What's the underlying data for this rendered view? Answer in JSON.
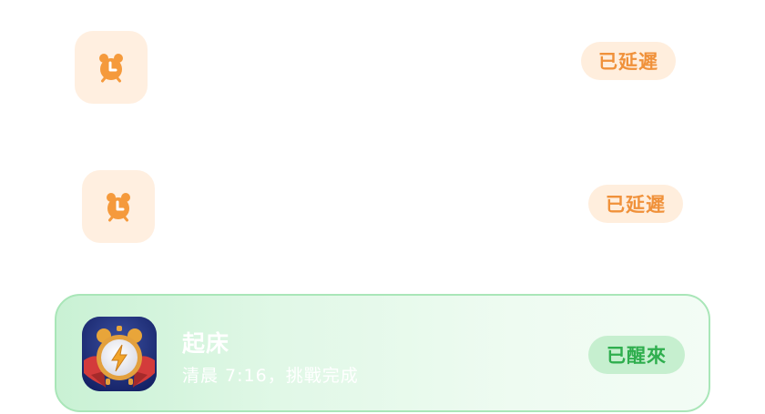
{
  "rows": [
    {
      "icon": "alarm-clock-icon",
      "status": "已延遲"
    },
    {
      "icon": "alarm-clock-icon",
      "status": "已延遲"
    }
  ],
  "active_card": {
    "app_icon": "superhero-alarm-app-icon",
    "title": "起床",
    "subtitle": "清晨 7:16，挑戰完成",
    "status": "已醒來"
  },
  "colors": {
    "delayed_text": "#f0913a",
    "delayed_bg": "#ffeedd",
    "awake_text": "#2fae4e",
    "awake_bg": "#c6efcf",
    "card_border": "#a9e6b8"
  }
}
